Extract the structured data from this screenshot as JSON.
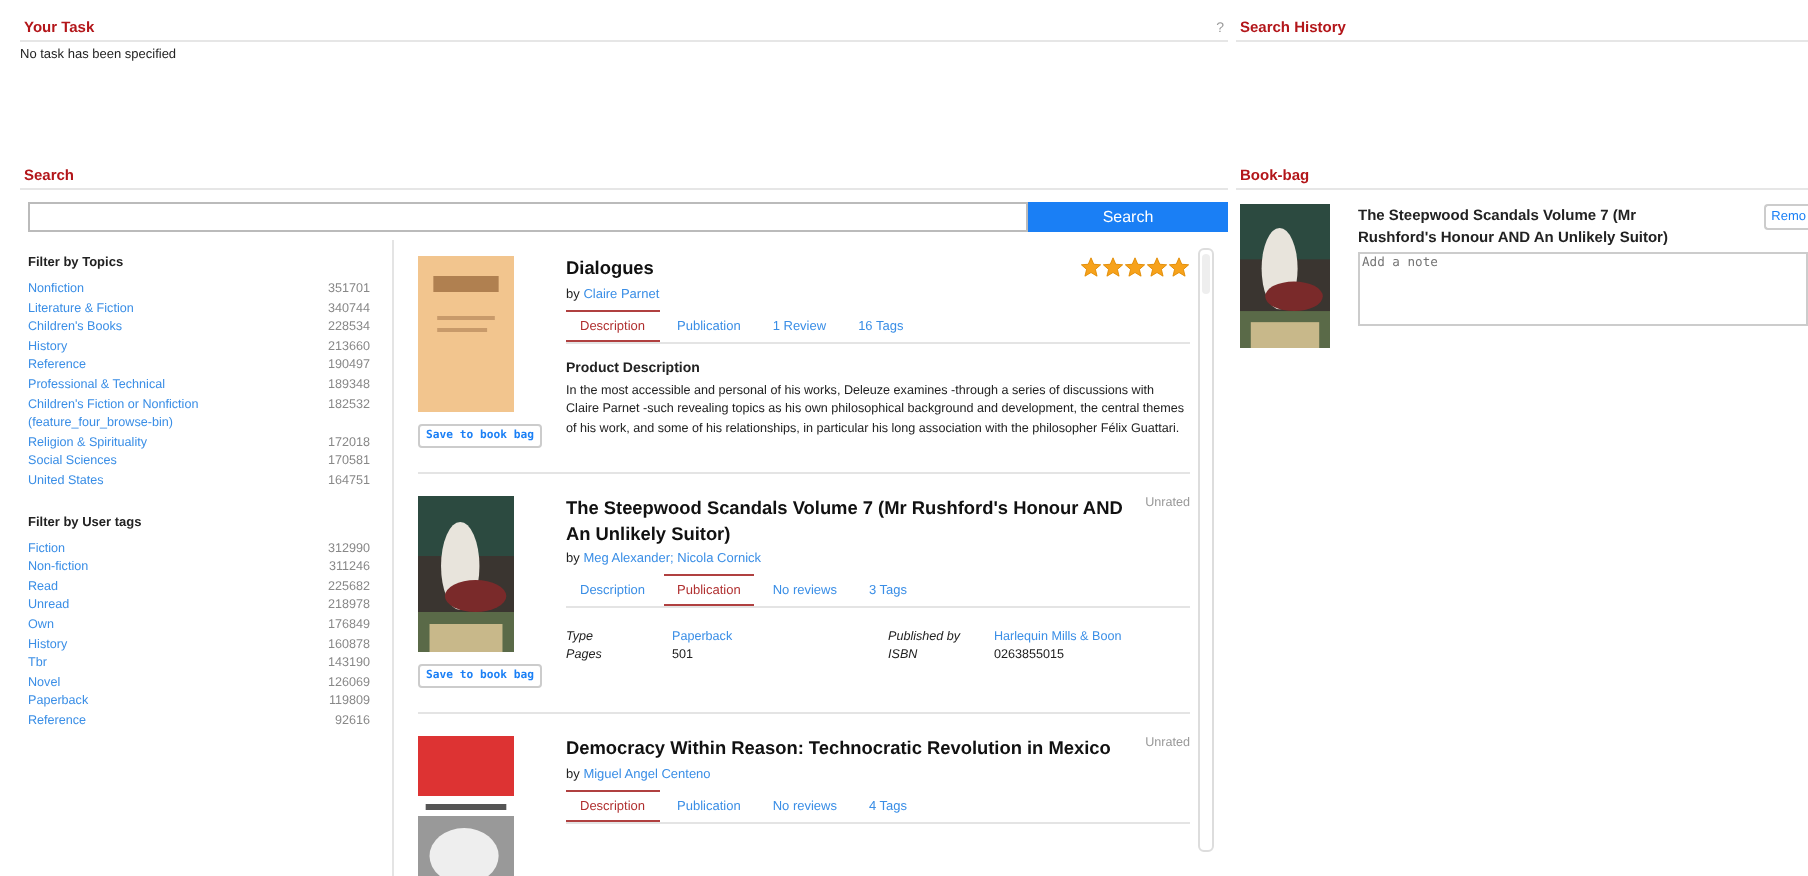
{
  "task": {
    "title": "Your Task",
    "help": "?",
    "text": "No task has been specified"
  },
  "history": {
    "title": "Search History"
  },
  "search": {
    "title": "Search",
    "button": "Search"
  },
  "filters": [
    {
      "title": "Filter by Topics",
      "items": [
        {
          "label": "Nonfiction",
          "count": "351701"
        },
        {
          "label": "Literature & Fiction",
          "count": "340744"
        },
        {
          "label": "Children's Books",
          "count": "228534"
        },
        {
          "label": "History",
          "count": "213660"
        },
        {
          "label": "Reference",
          "count": "190497"
        },
        {
          "label": "Professional & Technical",
          "count": "189348"
        },
        {
          "label": "Children's Fiction or Nonfiction (feature_four_browse-bin)",
          "count": "182532"
        },
        {
          "label": "Religion & Spirituality",
          "count": "172018"
        },
        {
          "label": "Social Sciences",
          "count": "170581"
        },
        {
          "label": "United States",
          "count": "164751"
        }
      ]
    },
    {
      "title": "Filter by User tags",
      "items": [
        {
          "label": "Fiction",
          "count": "312990"
        },
        {
          "label": "Non-fiction",
          "count": "311246"
        },
        {
          "label": "Read",
          "count": "225682"
        },
        {
          "label": "Unread",
          "count": "218978"
        },
        {
          "label": "Own",
          "count": "176849"
        },
        {
          "label": "History",
          "count": "160878"
        },
        {
          "label": "Tbr",
          "count": "143190"
        },
        {
          "label": "Novel",
          "count": "126069"
        },
        {
          "label": "Paperback",
          "count": "119809"
        },
        {
          "label": "Reference",
          "count": "92616"
        }
      ]
    }
  ],
  "results": [
    {
      "title": "Dialogues",
      "by": "by",
      "authors": "Claire Parnet",
      "stars": 5,
      "save": "Save to book bag",
      "tabs": [
        {
          "label": "Description",
          "selected": true
        },
        {
          "label": "Publication",
          "selected": false
        },
        {
          "label": "1 Review",
          "selected": false
        },
        {
          "label": "16 Tags",
          "selected": false
        }
      ],
      "detail": {
        "kind": "description",
        "heading": "Product Description",
        "text": "In the most accessible and personal of his works, Deleuze examines -through a series of discussions with Claire Parnet -such revealing topics as his own philosophical background and development, the central themes of his work, and some of his relationships, in particular his long association with the philosopher Félix Guattari."
      }
    },
    {
      "title": "The Steepwood Scandals Volume 7 (Mr Rushford's Honour AND An Unlikely Suitor)",
      "by": "by",
      "authors": "Meg Alexander; Nicola Cornick",
      "rating_label": "Unrated",
      "save": "Save to book bag",
      "tabs": [
        {
          "label": "Description",
          "selected": false
        },
        {
          "label": "Publication",
          "selected": true
        },
        {
          "label": "No reviews",
          "selected": false
        },
        {
          "label": "3 Tags",
          "selected": false
        }
      ],
      "detail": {
        "kind": "publication",
        "fields": [
          {
            "label": "Type",
            "value": "Paperback",
            "link": true
          },
          {
            "label": "Published by",
            "value": "Harlequin Mills & Boon",
            "link": true
          },
          {
            "label": "Pages",
            "value": "501",
            "link": false
          },
          {
            "label": "ISBN",
            "value": "0263855015",
            "link": false
          }
        ]
      }
    },
    {
      "title": "Democracy Within Reason: Technocratic Revolution in Mexico",
      "by": "by",
      "authors": "Miguel Angel Centeno",
      "rating_label": "Unrated",
      "tabs": [
        {
          "label": "Description",
          "selected": true
        },
        {
          "label": "Publication",
          "selected": false
        },
        {
          "label": "No reviews",
          "selected": false
        },
        {
          "label": "4 Tags",
          "selected": false
        }
      ]
    }
  ],
  "bookbag": {
    "title": "Book-bag",
    "items": [
      {
        "title": "The Steepwood Scandals Volume 7 (Mr Rushford's Honour AND An Unlikely Suitor)",
        "remove": "Remo",
        "note_placeholder": "Add a note"
      }
    ]
  }
}
